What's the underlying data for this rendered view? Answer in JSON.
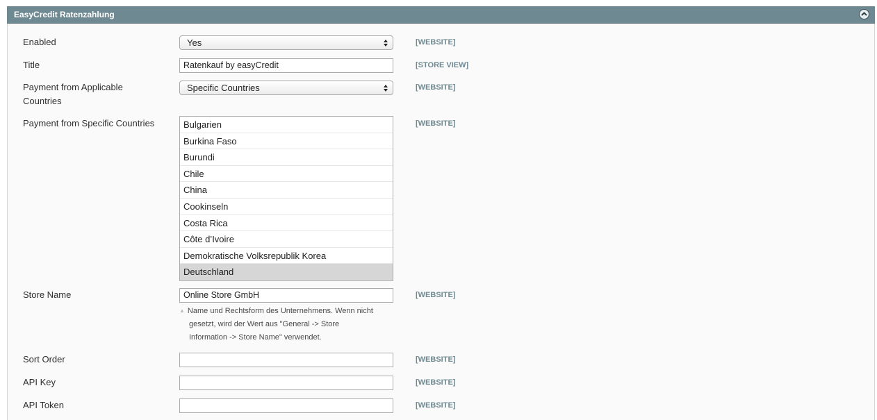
{
  "section": {
    "title": "EasyCredit Ratenzahlung",
    "collapse_icon": "chevron-up-circle-icon"
  },
  "fields": {
    "enabled": {
      "label": "Enabled",
      "value": "Yes",
      "scope": "[WEBSITE]"
    },
    "title": {
      "label": "Title",
      "value": "Ratenkauf by easyCredit",
      "scope": "[STORE VIEW]"
    },
    "applicable_countries": {
      "label_line1": "Payment from Applicable",
      "label_line2": "Countries",
      "value": "Specific Countries",
      "scope": "[WEBSITE]"
    },
    "specific_countries": {
      "label": "Payment from Specific Countries",
      "scope": "[WEBSITE]",
      "options": [
        "Bulgarien",
        "Burkina Faso",
        "Burundi",
        "Chile",
        "China",
        "Cookinseln",
        "Costa Rica",
        "Côte d’Ivoire",
        "Demokratische Volksrepublik Korea",
        "Deutschland"
      ],
      "selected": "Deutschland"
    },
    "store_name": {
      "label": "Store Name",
      "value": "Online Store GmbH",
      "scope": "[WEBSITE]",
      "note_line1": "Name und Rechtsform des Unternehmens. Wenn nicht",
      "note_line2": "gesetzt, wird der Wert aus \"General -> Store",
      "note_line3": "Information -> Store Name\" verwendet."
    },
    "sort_order": {
      "label": "Sort Order",
      "value": "",
      "scope": "[WEBSITE]"
    },
    "api_key": {
      "label": "API Key",
      "value": "",
      "scope": "[WEBSITE]"
    },
    "api_token": {
      "label": "API Token",
      "value": "",
      "scope": "[WEBSITE]"
    }
  },
  "colors": {
    "header_bg": "#6f8992",
    "scope_text": "#6f8992",
    "selected_option_bg": "#d6d6d6"
  }
}
